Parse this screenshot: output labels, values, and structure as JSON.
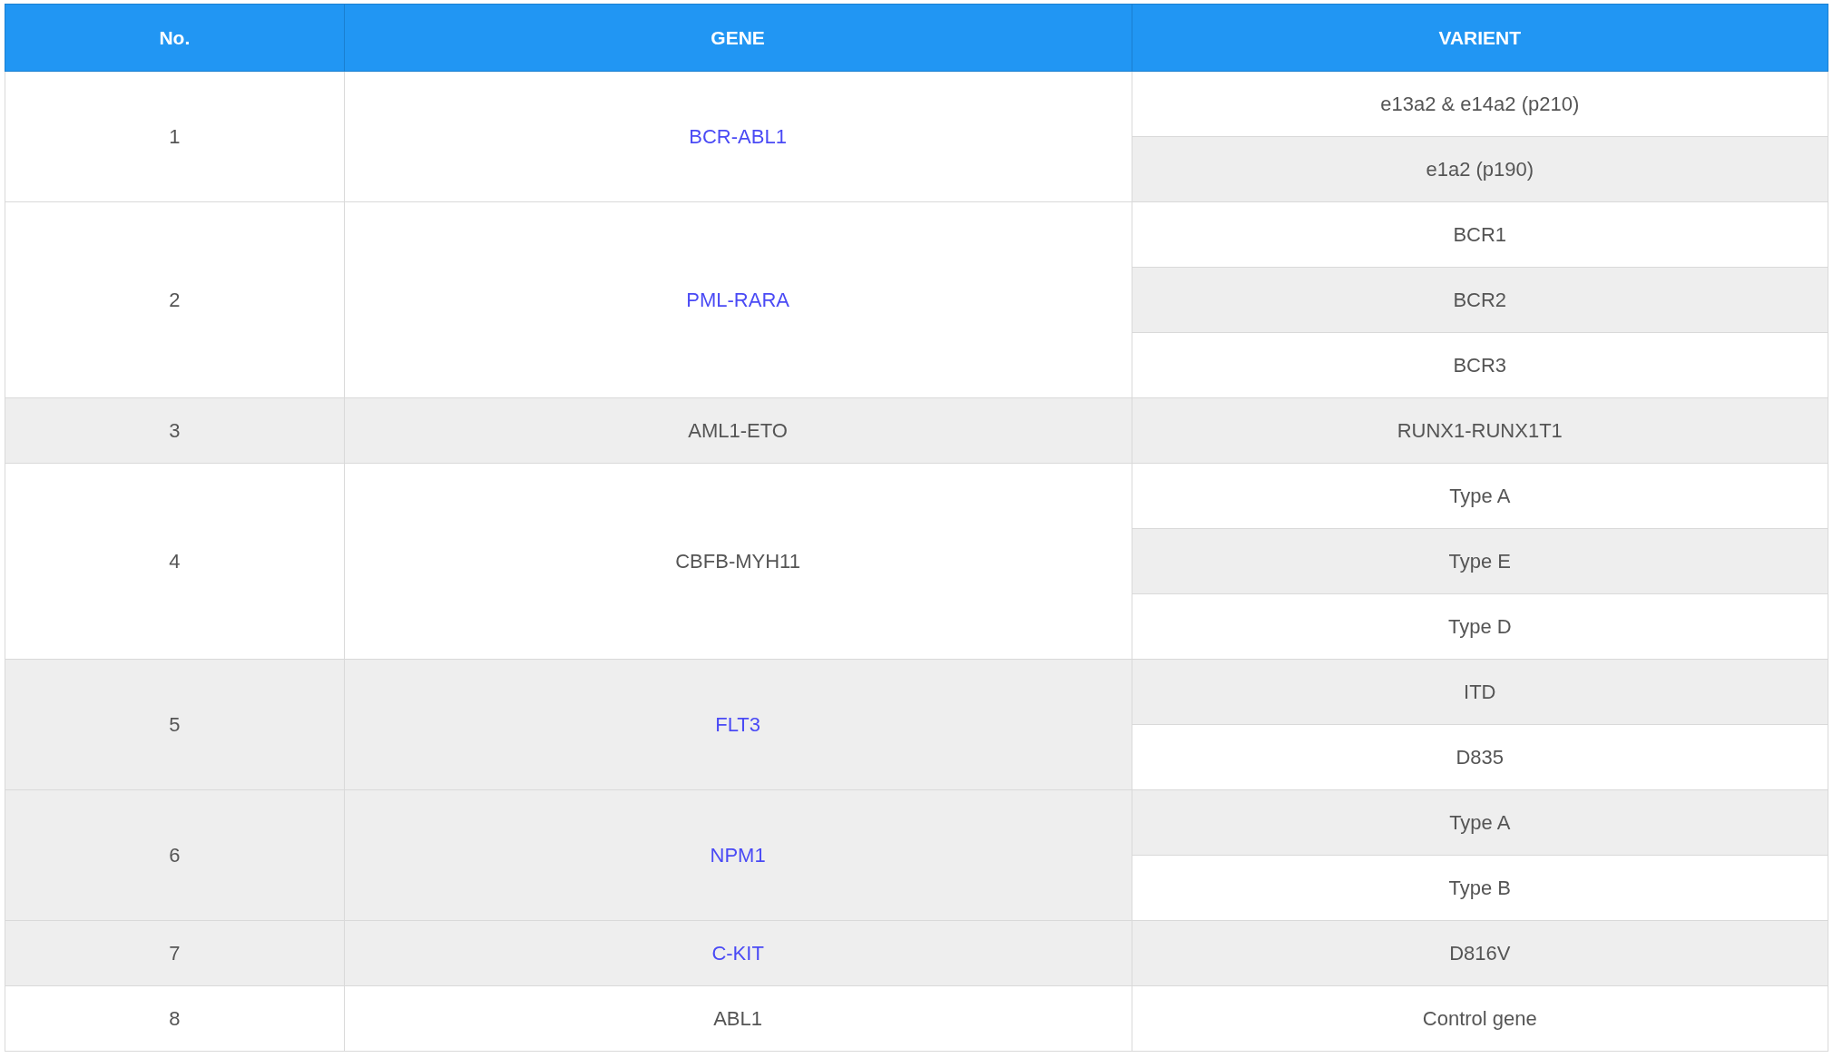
{
  "table": {
    "columns": [
      "No.",
      "GENE",
      "VARIENT"
    ],
    "rows": [
      {
        "no": "1",
        "gene": "BCR-ABL1",
        "link": true,
        "variants": [
          "e13a2 & e14a2 (p210)",
          "e1a2 (p190)"
        ]
      },
      {
        "no": "2",
        "gene": "PML-RARA",
        "link": true,
        "variants": [
          "BCR1",
          "BCR2",
          "BCR3"
        ]
      },
      {
        "no": "3",
        "gene": "AML1-ETO",
        "link": false,
        "variants": [
          "RUNX1-RUNX1T1"
        ]
      },
      {
        "no": "4",
        "gene": "CBFB-MYH11",
        "link": false,
        "variants": [
          "Type A",
          "Type E",
          "Type D"
        ]
      },
      {
        "no": "5",
        "gene": "FLT3",
        "link": true,
        "variants": [
          "ITD",
          "D835"
        ]
      },
      {
        "no": "6",
        "gene": "NPM1",
        "link": true,
        "variants": [
          "Type A",
          "Type B"
        ]
      },
      {
        "no": "7",
        "gene": "C-KIT",
        "link": true,
        "variants": [
          "D816V"
        ]
      },
      {
        "no": "8",
        "gene": "ABL1",
        "link": false,
        "variants": [
          "Control gene"
        ]
      }
    ]
  }
}
